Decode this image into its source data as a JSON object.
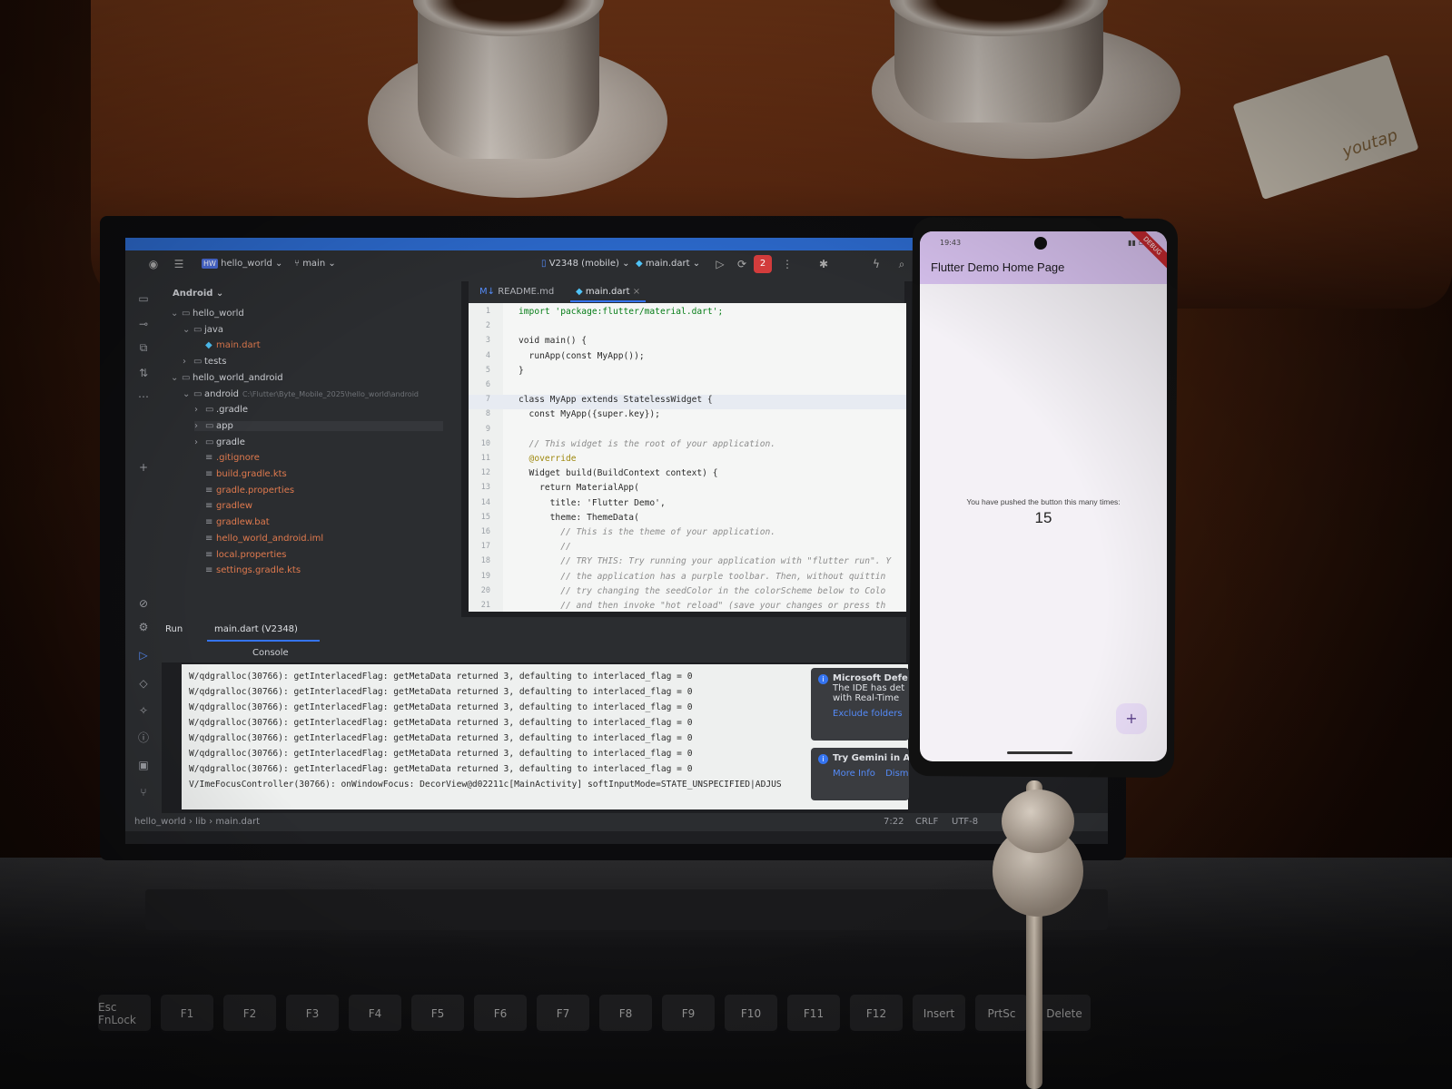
{
  "ide": {
    "project_name": "hello_world",
    "project_badge": "HW",
    "branch": "main",
    "device": "V2348 (mobile)",
    "run_config": "main.dart",
    "stop_badge": "2",
    "project_view": "Android",
    "tree": [
      {
        "label": "hello_world",
        "depth": 0,
        "icon": "folder-icon",
        "arrow": "⌄"
      },
      {
        "label": "java",
        "depth": 1,
        "icon": "folder-icon",
        "arrow": "⌄"
      },
      {
        "label": "main.dart",
        "depth": 2,
        "icon": "dart-file-icon",
        "arrow": ""
      },
      {
        "label": "tests",
        "depth": 1,
        "icon": "folder-icon",
        "arrow": "›"
      },
      {
        "label": "hello_world_android",
        "depth": 0,
        "icon": "folder-icon",
        "arrow": "⌄"
      },
      {
        "label": "android",
        "depth": 1,
        "icon": "folder-icon",
        "arrow": "⌄",
        "extra": "C:\\Flutter\\Byte_Mobile_2025\\hello_world\\android"
      },
      {
        "label": ".gradle",
        "depth": 2,
        "icon": "folder-icon",
        "arrow": "›"
      },
      {
        "label": "app",
        "depth": 2,
        "icon": "folder-icon",
        "arrow": "›",
        "selected": true
      },
      {
        "label": "gradle",
        "depth": 2,
        "icon": "folder-icon",
        "arrow": "›"
      },
      {
        "label": ".gitignore",
        "depth": 2,
        "icon": "ignore-file-icon",
        "arrow": ""
      },
      {
        "label": "build.gradle.kts",
        "depth": 2,
        "icon": "gradle-file-icon",
        "arrow": ""
      },
      {
        "label": "gradle.properties",
        "depth": 2,
        "icon": "settings-file-icon",
        "arrow": ""
      },
      {
        "label": "gradlew",
        "depth": 2,
        "icon": "file-icon",
        "arrow": ""
      },
      {
        "label": "gradlew.bat",
        "depth": 2,
        "icon": "file-icon",
        "arrow": ""
      },
      {
        "label": "hello_world_android.iml",
        "depth": 2,
        "icon": "file-icon",
        "arrow": ""
      },
      {
        "label": "local.properties",
        "depth": 2,
        "icon": "settings-file-icon",
        "arrow": ""
      },
      {
        "label": "settings.gradle.kts",
        "depth": 2,
        "icon": "gradle-file-icon",
        "arrow": ""
      }
    ],
    "tabs": [
      {
        "label": "README.md",
        "badge": "M↓"
      },
      {
        "label": "main.dart",
        "badge": "◆"
      }
    ],
    "code": [
      {
        "n": "1",
        "text": "import 'package:flutter/material.dart';"
      },
      {
        "n": "2",
        "text": ""
      },
      {
        "n": "3",
        "text": "void main() {"
      },
      {
        "n": "4",
        "text": "  runApp(const MyApp());"
      },
      {
        "n": "5",
        "text": "}"
      },
      {
        "n": "6",
        "text": ""
      },
      {
        "n": "7",
        "text": "class MyApp extends StatelessWidget {"
      },
      {
        "n": "8",
        "text": "  const MyApp({super.key});"
      },
      {
        "n": "9",
        "text": ""
      },
      {
        "n": "10",
        "text": "  // This widget is the root of your application."
      },
      {
        "n": "11",
        "text": "  @override"
      },
      {
        "n": "12",
        "text": "  Widget build(BuildContext context) {"
      },
      {
        "n": "13",
        "text": "    return MaterialApp("
      },
      {
        "n": "14",
        "text": "      title: 'Flutter Demo',"
      },
      {
        "n": "15",
        "text": "      theme: ThemeData("
      },
      {
        "n": "16",
        "text": "        // This is the theme of your application."
      },
      {
        "n": "17",
        "text": "        //"
      },
      {
        "n": "18",
        "text": "        // TRY THIS: Try running your application with \"flutter run\". Y"
      },
      {
        "n": "19",
        "text": "        // the application has a purple toolbar. Then, without quittin"
      },
      {
        "n": "20",
        "text": "        // try changing the seedColor in the colorScheme below to Colo"
      },
      {
        "n": "21",
        "text": "        // and then invoke \"hot reload\" (save your changes or press th"
      }
    ],
    "run_label": "Run",
    "run_tab": "main.dart (V2348)",
    "console_label": "Console",
    "console": [
      "W/qdgralloc(30766): getInterlacedFlag: getMetaData returned 3, defaulting to interlaced_flag = 0",
      "W/qdgralloc(30766): getInterlacedFlag: getMetaData returned 3, defaulting to interlaced_flag = 0",
      "W/qdgralloc(30766): getInterlacedFlag: getMetaData returned 3, defaulting to interlaced_flag = 0",
      "W/qdgralloc(30766): getInterlacedFlag: getMetaData returned 3, defaulting to interlaced_flag = 0",
      "W/qdgralloc(30766): getInterlacedFlag: getMetaData returned 3, defaulting to interlaced_flag = 0",
      "W/qdgralloc(30766): getInterlacedFlag: getMetaData returned 3, defaulting to interlaced_flag = 0",
      "W/qdgralloc(30766): getInterlacedFlag: getMetaData returned 3, defaulting to interlaced_flag = 0",
      "V/ImeFocusController(30766): onWindowFocus: DecorView@d02211c[MainActivity] softInputMode=STATE_UNSPECIFIED|ADJUS"
    ],
    "notif1": {
      "title": "Microsoft Defe",
      "line1": "The IDE has det",
      "line2": "with Real-Time",
      "link": "Exclude folders"
    },
    "notif2": {
      "title": "Try Gemini in An",
      "link1": "More Info",
      "link2": "Dismiss"
    },
    "status": {
      "breadcrumb1": "hello_world",
      "breadcrumb2": "lib",
      "breadcrumb3": "main.dart",
      "pos": "7:22",
      "eol": "CRLF",
      "enc": "UTF-8"
    }
  },
  "phone": {
    "time": "19:43",
    "app_title": "Flutter Demo Home Page",
    "body_label": "You have pushed the button this many times:",
    "counter": "15",
    "fab": "+",
    "ribbon": "DEBUG"
  },
  "receipt": {
    "brand": "youtap"
  },
  "keyboard": [
    "Esc FnLock",
    "F1",
    "F2",
    "F3",
    "F4",
    "F5",
    "F6",
    "F7",
    "F8",
    "F9",
    "F10",
    "F11",
    "F12",
    "Insert",
    "PrtSc",
    "Delete"
  ],
  "colors": {
    "ide_bg": "#1e1f22",
    "accent": "#3574f0",
    "appbar": "#d7c1ee",
    "stop": "#d33c3c"
  }
}
